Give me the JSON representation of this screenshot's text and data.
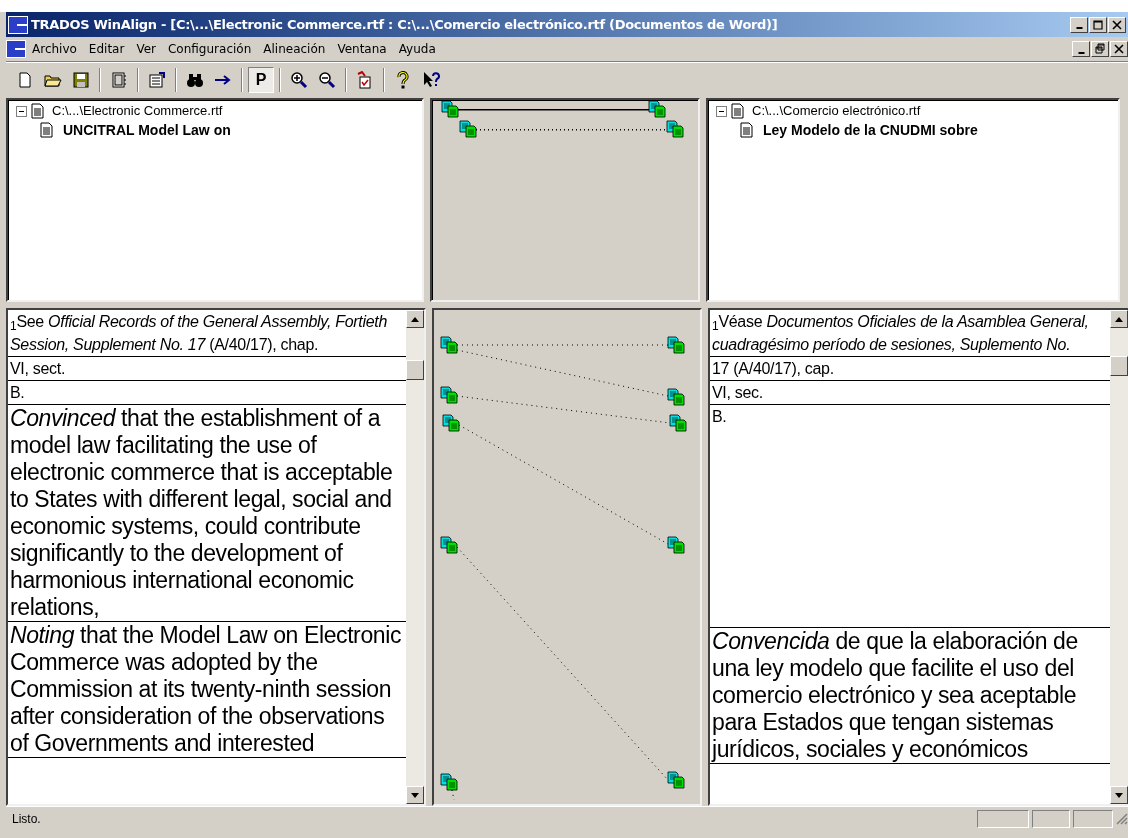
{
  "window": {
    "title": "TRADOS WinAlign - [C:\\...\\Electronic Commerce.rtf : C:\\...\\Comercio electrónico.rtf (Documentos de Word)]"
  },
  "menu": [
    "Archivo",
    "Editar",
    "Ver",
    "Configuración",
    "Alineación",
    "Ventana",
    "Ayuda"
  ],
  "toolbar": [
    {
      "kind": "new"
    },
    {
      "kind": "open"
    },
    {
      "kind": "save"
    },
    {
      "kind": "sep"
    },
    {
      "kind": "book"
    },
    {
      "kind": "sep"
    },
    {
      "kind": "properties"
    },
    {
      "kind": "sep"
    },
    {
      "kind": "find"
    },
    {
      "kind": "next"
    },
    {
      "kind": "sep"
    },
    {
      "kind": "toggle",
      "label": "P",
      "pressed": true
    },
    {
      "kind": "sep"
    },
    {
      "kind": "zoom_in"
    },
    {
      "kind": "zoom_out"
    },
    {
      "kind": "sep"
    },
    {
      "kind": "checklist"
    },
    {
      "kind": "sep"
    },
    {
      "kind": "help"
    },
    {
      "kind": "context_help"
    }
  ],
  "source_tree": {
    "label": "C:\\...\\Electronic Commerce.rtf",
    "expanded": true,
    "children": [
      {
        "label": "UNCITRAL Model Law on"
      }
    ]
  },
  "target_tree": {
    "label": "C:\\...\\Comercio electrónico.rtf",
    "expanded": true,
    "children": [
      {
        "label": "Ley Modelo de la CNUDMI sobre"
      }
    ]
  },
  "outline_links": [
    {
      "confirmed": true
    },
    {
      "confirmed": false
    }
  ],
  "source_segments": [
    {
      "kind": "note",
      "text": "$_{1}$See *Official Records of the General Assembly, Fortieth Session, Supplement No. 17* (A/40/17), chap."
    },
    {
      "kind": "note",
      "text": "VI, sect."
    },
    {
      "kind": "note",
      "text": "B."
    },
    {
      "kind": "body",
      "text": "*Convinced* that the establishment of a model law facilitating the use of electronic commerce that is acceptable to States with different legal, social and economic systems, could contribute significantly to the development of harmonious international economic relations,"
    },
    {
      "kind": "body",
      "text": "*Noting* that the Model Law on Electronic Commerce was adopted by the Commission at its twenty-ninth session after consideration of the observations of Governments and interested"
    }
  ],
  "target_segments": [
    {
      "kind": "note",
      "text": "$_{1}$Véase *Documentos Oficiales de la Asamblea General, cuadragésimo período de sesiones, Suplemento No.*"
    },
    {
      "kind": "note",
      "text": "17 (A/40/17), cap."
    },
    {
      "kind": "note",
      "text": "VI, sec."
    },
    {
      "kind": "note",
      "text": "B.",
      "tall": true
    },
    {
      "kind": "body",
      "text": "*Convencida* de que la elaboración de una ley modelo que facilite el uso del comercio electrónico y sea aceptable para Estados que tengan sistemas jurídicos, sociales y económicos"
    }
  ],
  "status_bar": {
    "text": "Listo."
  }
}
